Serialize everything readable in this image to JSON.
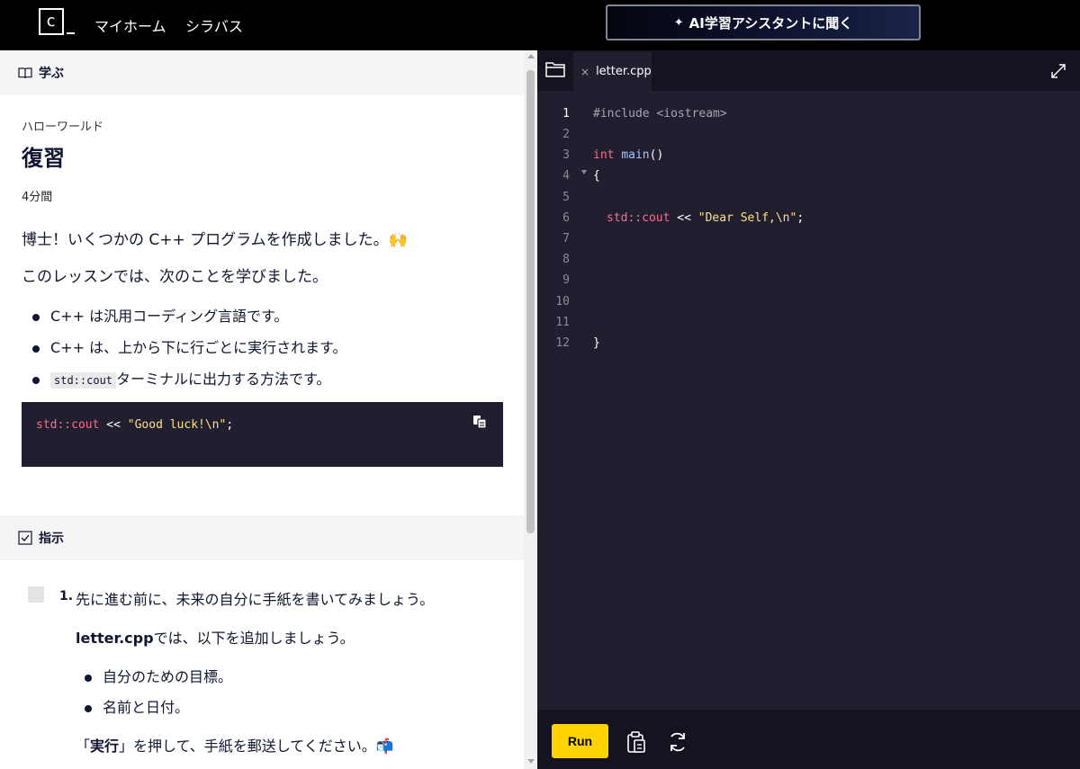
{
  "topbar": {
    "logo_text": "c",
    "nav": [
      "マイホーム",
      "シラバス"
    ],
    "ai_button": "AI学習アシスタントに聞く"
  },
  "learn": {
    "section_label": "学ぶ",
    "breadcrumb": "ハローワールド",
    "title": "復習",
    "duration": "4分間",
    "intro": "博士！いくつかの C++ プログラムを作成しました。🙌",
    "lead": "このレッスンでは、次のことを学びました。",
    "bullets": [
      "C++ は汎用コーディング言語です。",
      "C++ は、上から下に行ごとに実行されます。"
    ],
    "bullet3_code": "std::cout",
    "bullet3_text": "ターミナルに出力する方法です。",
    "snippet": {
      "identifier": "std::cout",
      "operator": " << ",
      "string": "\"Good luck!\\n\"",
      "end": ";"
    }
  },
  "instructions": {
    "section_label": "指示",
    "task_number": "1.",
    "task_text": "先に進む前に、未来の自分に手紙を書いてみましょう。",
    "file_name": "letter.cpp",
    "add_text": "では、以下を追加しましょう。",
    "items": [
      "自分のための目標。",
      "名前と日付。"
    ],
    "run_open": "「",
    "run_word": "実行",
    "run_close": "」を押して、手紙を郵送してください。📬"
  },
  "editor": {
    "tab_close": "×",
    "file_name": "letter.cpp",
    "line_numbers": [
      "1",
      "2",
      "3",
      "4",
      "5",
      "6",
      "7",
      "8",
      "9",
      "10",
      "11",
      "12"
    ],
    "line1": "#include <iostream>",
    "line3_kw": "int",
    "line3_fn": "main",
    "line3_rest": "()",
    "line4": "{",
    "line6_ident": "std::cout",
    "line6_op": " << ",
    "line6_str": "\"Dear Self,\\n\"",
    "line6_end": ";",
    "line12": "}",
    "run_label": "Run"
  },
  "colors": {
    "accent": "#ffd300",
    "editor_bg": "#211e2f",
    "keyword": "#ff6b8b",
    "string": "#ffe08a",
    "function": "#a8c3ff"
  }
}
